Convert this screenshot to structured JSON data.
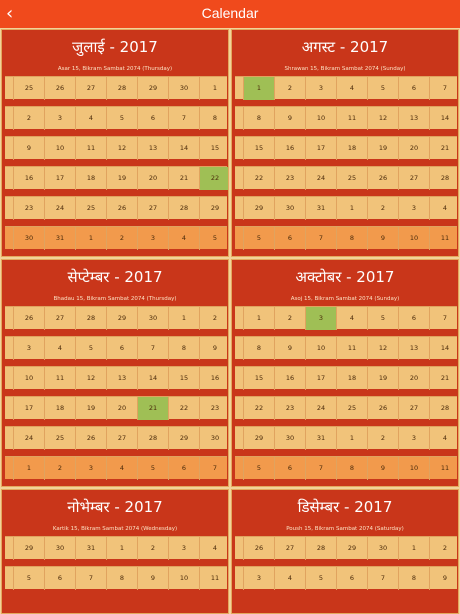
{
  "app": {
    "title": "Calendar",
    "back_icon": "chevron-left-icon"
  },
  "months": [
    {
      "name": "जुलाई  -  2017",
      "info": "Asar 15, Bikram Sambat 2074 (Thursday)",
      "weeks": [
        [
          "25",
          "26",
          "27",
          "28",
          "29",
          "30",
          "1"
        ],
        [
          "2",
          "3",
          "4",
          "5",
          "6",
          "7",
          "8"
        ],
        [
          "9",
          "10",
          "11",
          "12",
          "13",
          "14",
          "15"
        ],
        [
          "16",
          "17",
          "18",
          "19",
          "20",
          "21",
          "22"
        ],
        [
          "23",
          "24",
          "25",
          "26",
          "27",
          "28",
          "29"
        ],
        [
          "30",
          "31",
          "1",
          "2",
          "3",
          "4",
          "5"
        ]
      ],
      "today": [
        3,
        6
      ]
    },
    {
      "name": "अगस्ट  -  2017",
      "info": "Shrawan 15, Bikram Sambat 2074 (Sunday)",
      "weeks": [
        [
          "1",
          "2",
          "3",
          "4",
          "5",
          "6",
          "7"
        ],
        [
          "8",
          "9",
          "10",
          "11",
          "12",
          "13",
          "14"
        ],
        [
          "15",
          "16",
          "17",
          "18",
          "19",
          "20",
          "21"
        ],
        [
          "22",
          "23",
          "24",
          "25",
          "26",
          "27",
          "28"
        ],
        [
          "29",
          "30",
          "31",
          "1",
          "2",
          "3",
          "4"
        ],
        [
          "5",
          "6",
          "7",
          "8",
          "9",
          "10",
          "11"
        ]
      ],
      "today": [
        0,
        0
      ]
    },
    {
      "name": "सेप्टेम्बर  -  2017",
      "info": "Bhadau 15, Bikram Sambat 2074 (Thursday)",
      "weeks": [
        [
          "26",
          "27",
          "28",
          "29",
          "30",
          "1",
          "2"
        ],
        [
          "3",
          "4",
          "5",
          "6",
          "7",
          "8",
          "9"
        ],
        [
          "10",
          "11",
          "12",
          "13",
          "14",
          "15",
          "16"
        ],
        [
          "17",
          "18",
          "19",
          "20",
          "21",
          "22",
          "23"
        ],
        [
          "24",
          "25",
          "26",
          "27",
          "28",
          "29",
          "30"
        ],
        [
          "1",
          "2",
          "3",
          "4",
          "5",
          "6",
          "7"
        ]
      ],
      "today": [
        3,
        4
      ]
    },
    {
      "name": "अक्टोबर  -  2017",
      "info": "Asoj 15, Bikram Sambat 2074 (Sunday)",
      "weeks": [
        [
          "1",
          "2",
          "3",
          "4",
          "5",
          "6",
          "7"
        ],
        [
          "8",
          "9",
          "10",
          "11",
          "12",
          "13",
          "14"
        ],
        [
          "15",
          "16",
          "17",
          "18",
          "19",
          "20",
          "21"
        ],
        [
          "22",
          "23",
          "24",
          "25",
          "26",
          "27",
          "28"
        ],
        [
          "29",
          "30",
          "31",
          "1",
          "2",
          "3",
          "4"
        ],
        [
          "5",
          "6",
          "7",
          "8",
          "9",
          "10",
          "11"
        ]
      ],
      "today": [
        0,
        2
      ]
    },
    {
      "name": "नोभेम्बर  -  2017",
      "info": "Kartik 15, Bikram Sambat 2074 (Wednesday)",
      "weeks": [
        [
          "29",
          "30",
          "31",
          "1",
          "2",
          "3",
          "4"
        ],
        [
          "5",
          "6",
          "7",
          "8",
          "9",
          "10",
          "11"
        ]
      ],
      "today": [
        -1,
        -1
      ]
    },
    {
      "name": "डिसेम्बर  -  2017",
      "info": "Poush 15, Bikram Sambat 2074 (Saturday)",
      "weeks": [
        [
          "26",
          "27",
          "28",
          "29",
          "30",
          "1",
          "2"
        ],
        [
          "3",
          "4",
          "5",
          "6",
          "7",
          "8",
          "9"
        ]
      ],
      "today": [
        -1,
        -1
      ]
    }
  ]
}
